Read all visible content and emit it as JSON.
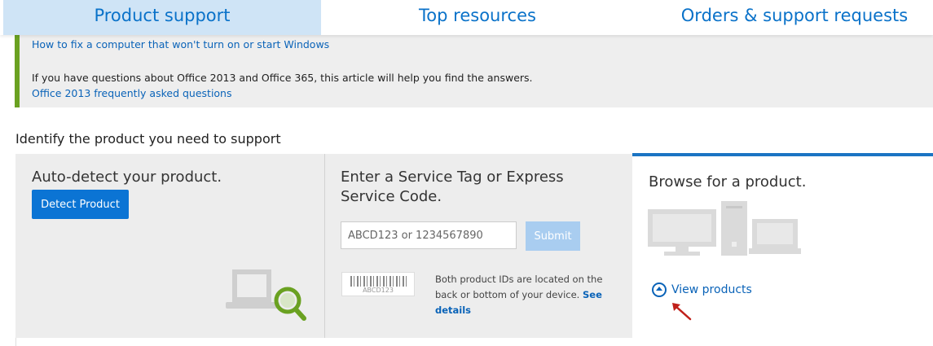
{
  "nav": {
    "tabs": [
      {
        "label": "Product support",
        "active": true
      },
      {
        "label": "Top resources"
      },
      {
        "label": "Orders & support requests"
      }
    ]
  },
  "notice": {
    "link1": "How to fix a computer that won't turn on or start Windows",
    "question": "If you have questions about Office 2013 and Office 365, this article will help you find the answers.",
    "link2": "Office 2013 frequently asked questions",
    "accent": "#6aa121"
  },
  "identify": {
    "title": "Identify the product you need to support"
  },
  "auto_detect": {
    "heading": "Auto-detect your product.",
    "button": "Detect Product",
    "icon": "laptop-magnifier-icon"
  },
  "service_tag": {
    "heading": "Enter a Service Tag or Express Service Code.",
    "placeholder": "ABCD123 or 1234567890",
    "submit": "Submit",
    "barcode_text": "ABCD123",
    "note": "Both product IDs are located on the back or bottom of your device.",
    "note_link": "See details"
  },
  "browse": {
    "heading": "Browse for a product.",
    "view_products": "View products",
    "icon": "computers-icon"
  },
  "colors": {
    "brand_blue": "#0b74d4",
    "link_blue": "#0a63b8",
    "submit_disabled": "#a9cdf0"
  }
}
